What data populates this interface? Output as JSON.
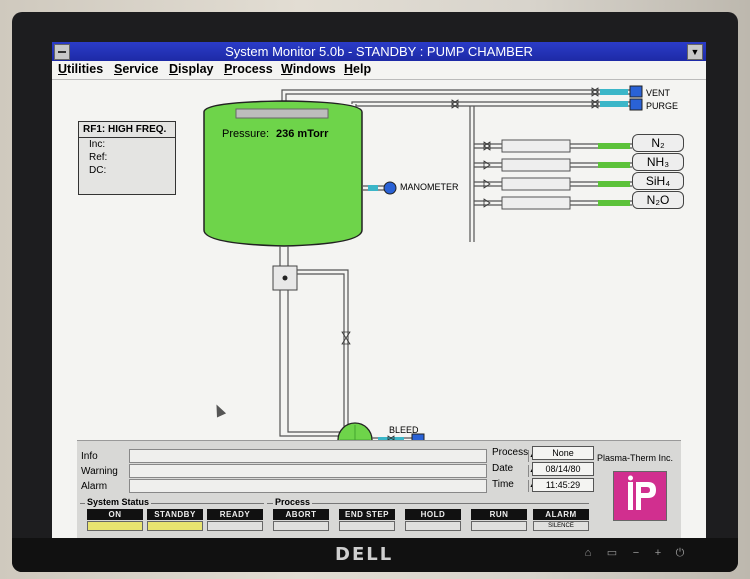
{
  "window": {
    "title": "System Monitor 5.0b - STANDBY : PUMP CHAMBER",
    "min_glyph": "▼"
  },
  "menu": [
    {
      "label": "Utilities"
    },
    {
      "label": "Service"
    },
    {
      "label": "Display"
    },
    {
      "label": "Process"
    },
    {
      "label": "Windows"
    },
    {
      "label": "Help"
    }
  ],
  "rf": {
    "title": "RF1: HIGH FREQ.",
    "lines": [
      "Inc:",
      "Ref:",
      "DC:"
    ]
  },
  "chamber": {
    "pressure_label": "Pressure:",
    "pressure_value": "236 mTorr",
    "fill_color": "#6ed44a"
  },
  "labels": {
    "manometer": "MANOMETER",
    "vent": "VENT",
    "purge": "PURGE",
    "bleed": "BLEED",
    "n2_badge": "N2"
  },
  "gases": [
    {
      "label": "N₂"
    },
    {
      "label": "NH₃"
    },
    {
      "label": "SiH₄"
    },
    {
      "label": "N₂O"
    }
  ],
  "messages": [
    {
      "label": "Info",
      "value": ""
    },
    {
      "label": "Warning",
      "value": ""
    },
    {
      "label": "Alarm",
      "value": ""
    }
  ],
  "process_info": {
    "process_label": "Process",
    "process_value": "None",
    "date_label": "Date",
    "date_value": "08/14/80",
    "time_label": "Time",
    "time_value": "11:45:29"
  },
  "company": "Plasma-Therm Inc.",
  "system_status": {
    "label": "System Status",
    "buttons": [
      {
        "label": "ON",
        "active": true
      },
      {
        "label": "STANDBY",
        "active": true
      },
      {
        "label": "READY",
        "active": false
      }
    ]
  },
  "process": {
    "label": "Process",
    "buttons": [
      {
        "label": "ABORT"
      },
      {
        "label": "END STEP"
      },
      {
        "label": "HOLD"
      },
      {
        "label": "RUN"
      },
      {
        "label": "ALARM",
        "sub": "SILENCE"
      }
    ]
  },
  "monitor": {
    "brand": "DELL"
  }
}
